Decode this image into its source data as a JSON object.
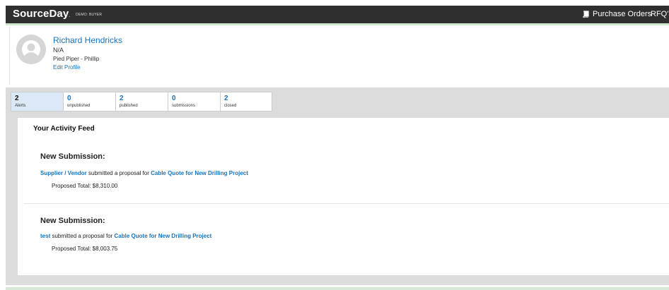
{
  "header": {
    "brand": "SourceDay",
    "brand_mark": ".",
    "environment": "DEMO: BUYER",
    "nav_purchase_orders": "Purchase Orders",
    "nav_rfqs": "RFQ's",
    "icons": {
      "purchase_orders": "book-icon"
    }
  },
  "profile": {
    "name": "Richard Hendricks",
    "role": "N/A",
    "company": "Pied Piper - Phillip",
    "edit_link": "Edit Profile"
  },
  "tabs": [
    {
      "count": "2",
      "label": "Alerts",
      "active": true
    },
    {
      "count": "0",
      "label": "unpublished",
      "active": false
    },
    {
      "count": "2",
      "label": "published",
      "active": false
    },
    {
      "count": "0",
      "label": "submissions",
      "active": false
    },
    {
      "count": "2",
      "label": "closed",
      "active": false
    }
  ],
  "feed": {
    "title": "Your Activity Feed",
    "entries": [
      {
        "heading": "New Submission:",
        "actor": "Supplier / Vendor",
        "action": "submitted a proposal for",
        "subject": "Cable Quote for New Drilling Project",
        "total": "Proposed Total: $8,310.00"
      },
      {
        "heading": "New Submission:",
        "actor": "test",
        "action": "submitted a proposal for",
        "subject": "Cable Quote for New Drilling Project",
        "total": "Proposed Total: $8,003.75"
      }
    ]
  },
  "colors": {
    "topbar": "#2f2f2f",
    "link": "#1a72b9",
    "panel": "#dcdcdc",
    "active_tab": "#dbe9f6",
    "accent_line": "#cfe6cf"
  }
}
